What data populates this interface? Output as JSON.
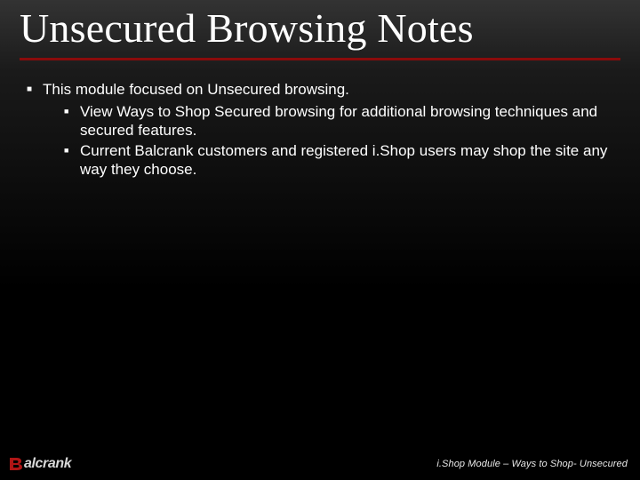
{
  "title": "Unsecured Browsing Notes",
  "bullets": {
    "l1_1": "This module focused on Unsecured browsing.",
    "l2_1": "View Ways to Shop Secured browsing for additional browsing techniques and secured features.",
    "l2_2": "Current Balcrank customers and registered i.Shop users may shop the site any way they choose."
  },
  "footer": {
    "logo_text": "alcrank",
    "module_text": "i.Shop Module – Ways to Shop- Unsecured"
  }
}
